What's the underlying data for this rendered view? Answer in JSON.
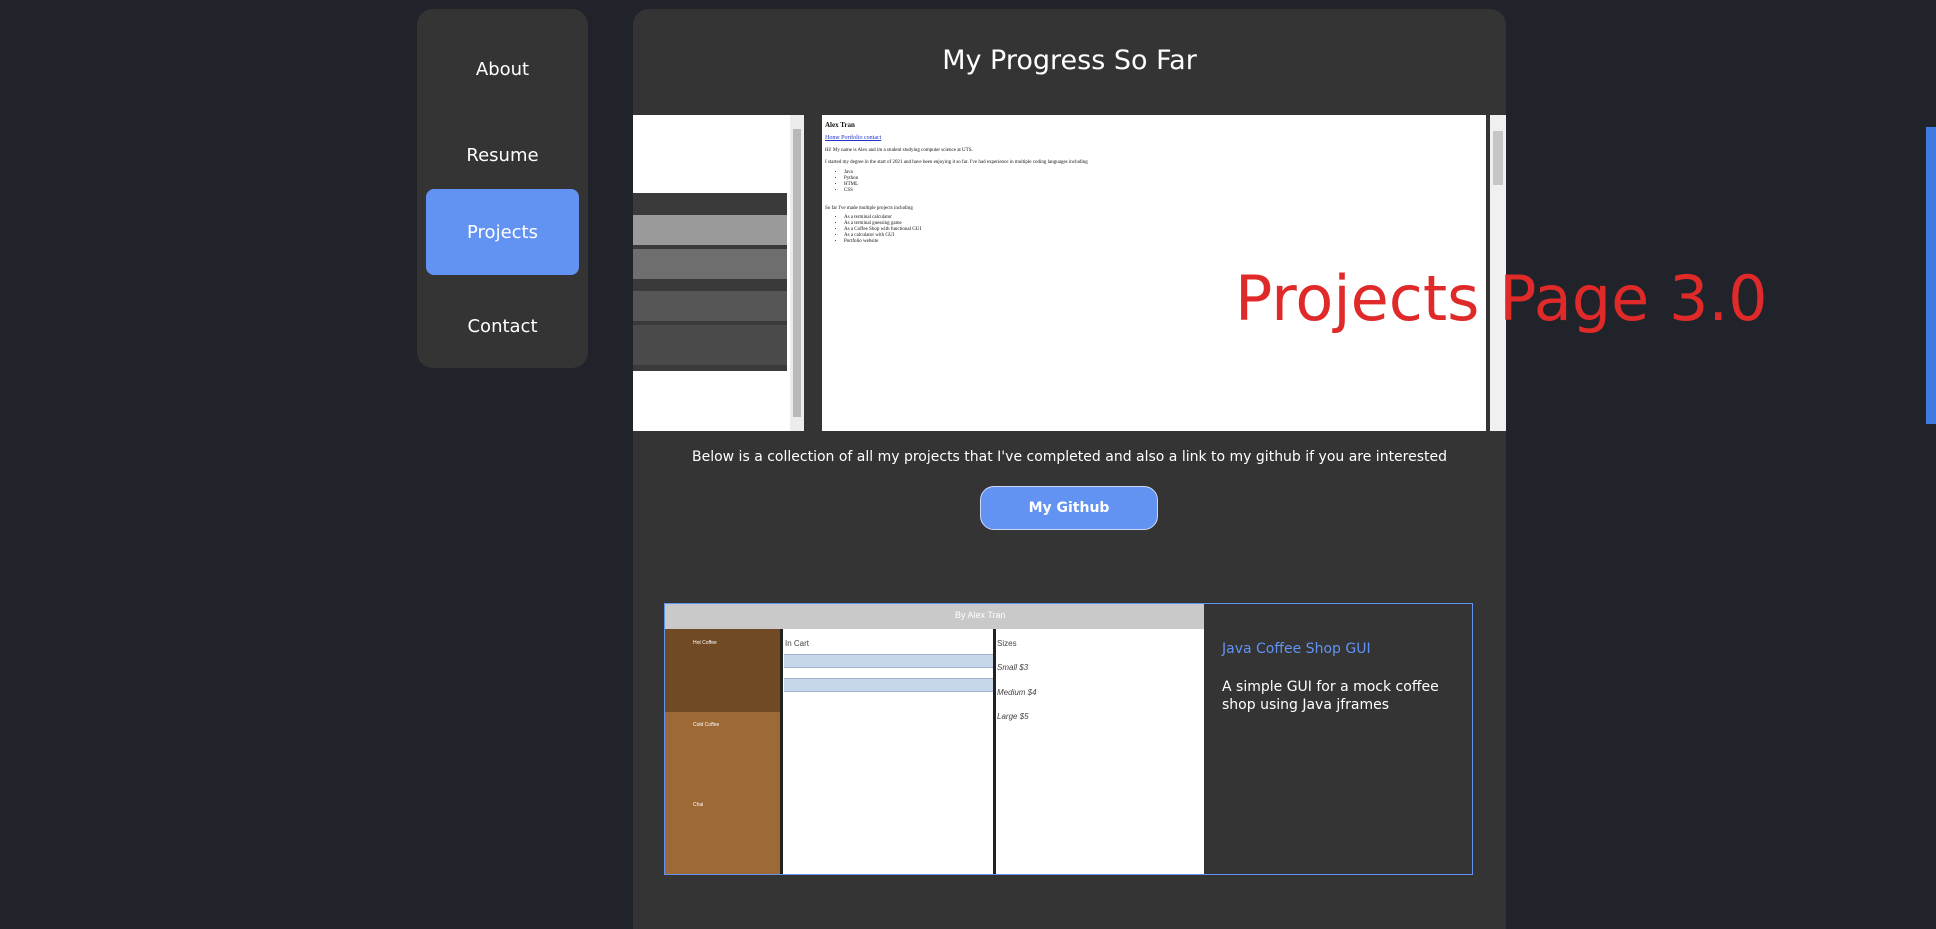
{
  "nav": {
    "items": [
      {
        "label": "About"
      },
      {
        "label": "Resume"
      },
      {
        "label": "Projects",
        "active": true
      },
      {
        "label": "Contact"
      }
    ]
  },
  "main": {
    "title": "My Progress So Far",
    "carousel": {
      "preview": {
        "name": "Alex Tran",
        "links": "Home Portfolio contact",
        "intro": "Hi! My name is Alex and im a student studying computer science at UTS.",
        "degree": "I started my degree in the start of 2021 and have been enjoying it so far. I've had experience in multiple coding languages including",
        "languages": [
          "Java",
          "Python",
          "HTML",
          "CSS"
        ],
        "projects_intro": "So far I've made multiple projects including",
        "projects": [
          "As a terminal calculator",
          "As a terminal guessing game",
          "As a Coffee Shop with functional GUI",
          "As a calculator with GUI",
          "Portfolio website"
        ]
      },
      "watermark": "Projects Page 3.0"
    },
    "blurb": "Below is a collection of all my projects that I've completed and also a link to my github if you are interested",
    "github_label": "My Github",
    "project": {
      "title": "Java Coffee Shop GUI",
      "description": "A simple GUI for a mock coffee shop using Java jframes",
      "screenshot": {
        "window_title": "By Alex Tran",
        "cart_label": "In Cart",
        "sizes_label": "Sizes",
        "sizes": [
          "Small $3",
          "Medium $4",
          "Large $5"
        ],
        "items": [
          "Hot Coffee",
          "Cold Coffee",
          "Chai"
        ]
      }
    }
  },
  "colors": {
    "accent": "#6393f2",
    "background": "#202329",
    "panel": "#343434",
    "watermark": "#e02a2a"
  }
}
